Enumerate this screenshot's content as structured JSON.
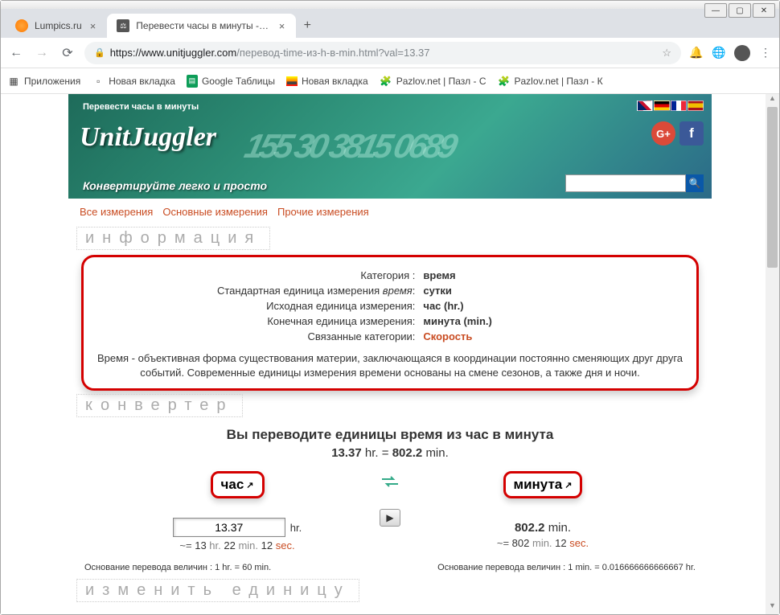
{
  "window": {
    "minimize": "—",
    "maximize": "▢",
    "close": "✕"
  },
  "tabs": {
    "items": [
      {
        "title": "Lumpics.ru"
      },
      {
        "title": "Перевести часы в минуты - Пер"
      }
    ],
    "newtab": "+"
  },
  "address": {
    "scheme": "https://",
    "host": "www.unitjuggler.com",
    "path": "/перевод-time-из-h-в-min.html?val=13.37",
    "star": "☆"
  },
  "bookmarks": {
    "apps": "Приложения",
    "items": [
      "Новая вкладка",
      "Google Таблицы",
      "Новая вкладка",
      "Pazlov.net | Пазл - С",
      "Pazlov.net | Пазл - К"
    ]
  },
  "header": {
    "breadcrumb": "Перевести часы в минуты",
    "logo": "UnitJuggler",
    "tagline": "Конвертируйте легко и просто",
    "bg_numbers": "155 30 3815 0689",
    "social_gp": "G+",
    "social_fb": "f",
    "search_placeholder": ""
  },
  "nav": {
    "items": [
      "Все измерения",
      "Основные измерения",
      "Прочие измерения"
    ]
  },
  "sections": {
    "info": "информация",
    "converter": "конвертер",
    "change": "изменить единицу"
  },
  "info": {
    "rows": [
      {
        "label": "Категория :",
        "value": "время"
      },
      {
        "label_pre": "Стандартная единица измерения ",
        "label_italic": "время",
        "label_post": ":",
        "value": "сутки"
      },
      {
        "label": "Исходная единица измерения:",
        "value": "час (hr.)"
      },
      {
        "label": "Конечная единица измерения:",
        "value": "минута (min.)"
      },
      {
        "label": "Связанные категории:",
        "value_link": "Скорость"
      }
    ],
    "description": "Время - объективная форма существования материи, заключающаяся в координации постоянно сменяющих друг друга событий. Современные единицы измерения времени основаны на смене сезонов, а также дня и ночи."
  },
  "converter": {
    "heading": "Вы переводите единицы время из час в минута",
    "equation_lhs": "13.37",
    "equation_lunit": "hr.",
    "equation_eq": "=",
    "equation_rhs": "802.2",
    "equation_runit": "min.",
    "left": {
      "unit": "час",
      "input_value": "13.37",
      "input_unit": "hr.",
      "approx_prefix": "~= ",
      "approx_parts": [
        {
          "n": "13",
          "u": " hr. "
        },
        {
          "n": "22",
          "u": " min. "
        },
        {
          "n": "12",
          "u": " sec."
        }
      ],
      "basis": "Основание перевода величин : 1 hr. = 60 min."
    },
    "right": {
      "unit": "минута",
      "result_value": "802.2",
      "result_unit": "min.",
      "approx_prefix": "~= ",
      "approx_parts": [
        {
          "n": "802",
          "u": " min. "
        },
        {
          "n": "12",
          "u": " sec."
        }
      ],
      "basis": "Основание перевода величин : 1 min. = 0.016666666666667 hr."
    }
  }
}
